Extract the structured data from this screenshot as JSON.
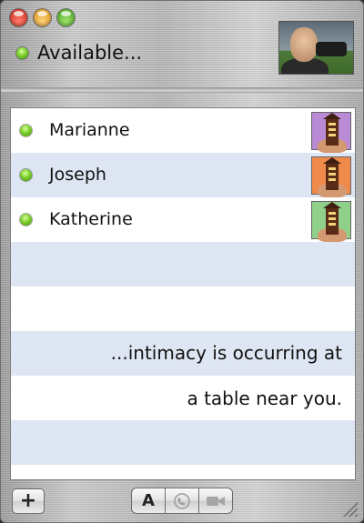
{
  "window": {
    "controls": [
      "close",
      "minimize",
      "zoom"
    ]
  },
  "status": {
    "label": "Available...",
    "indicator_color": "#6ac125"
  },
  "user_photo": {
    "icon": "user-photo"
  },
  "buddies": [
    {
      "name": "Marianne",
      "status": "available",
      "icon_bg": "#b98ad6"
    },
    {
      "name": "Joseph",
      "status": "available",
      "icon_bg": "#f08a4b"
    },
    {
      "name": "Katherine",
      "status": "available",
      "icon_bg": "#8fd08a"
    }
  ],
  "caption": {
    "line1": "...intimacy is occurring at",
    "line2": "a table near you."
  },
  "toolbar": {
    "add_label": "+",
    "text_chat_label": "A",
    "audio_icon": "phone-icon",
    "video_icon": "video-camera-icon"
  },
  "colors": {
    "row_alt": "#dfe6f3",
    "row_white": "#ffffff"
  }
}
